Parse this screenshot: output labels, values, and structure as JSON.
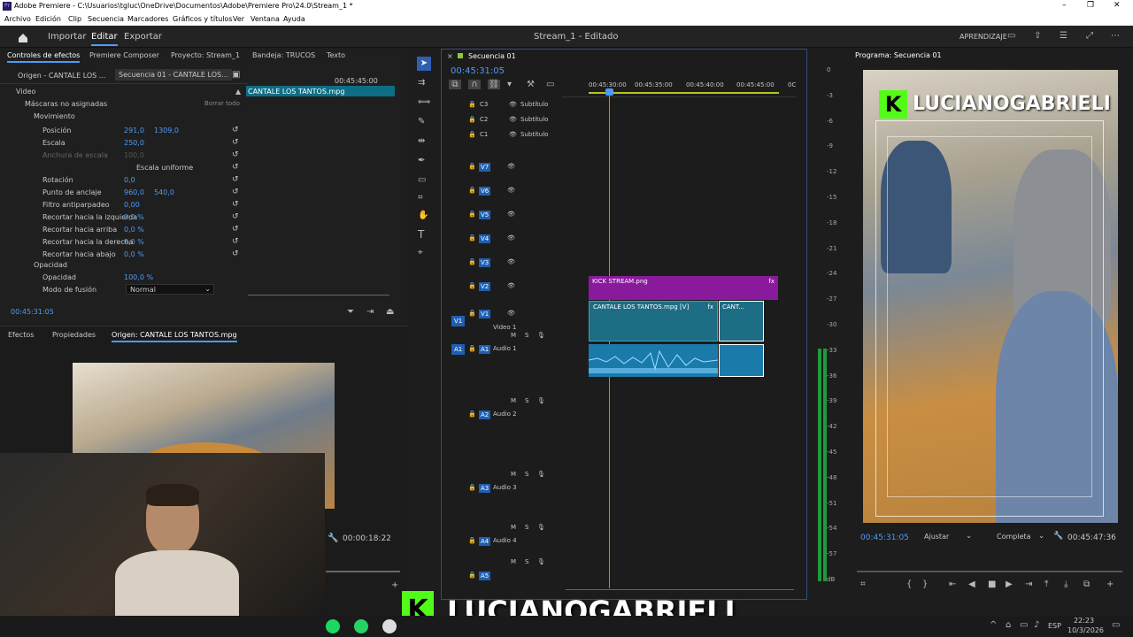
{
  "window": {
    "title": "Adobe Premiere - C:\\Usuarios\\tgluc\\OneDrive\\Documentos\\Adobe\\Premiere Pro\\24.0\\Stream_1 *",
    "controls": [
      "–",
      "❐",
      "✕"
    ]
  },
  "menu": [
    "Archivo",
    "Edición",
    "Clip",
    "Secuencia",
    "Marcadores",
    "Gráficos y títulos",
    "Ver",
    "Ventana",
    "Ayuda"
  ],
  "appbar": {
    "tabs": [
      "Importar",
      "Editar",
      "Exportar"
    ],
    "active": "Editar",
    "center": "Stream_1 - Editado",
    "right": "APRENDIZAJE"
  },
  "panel_tabs": [
    "Controles de efectos",
    "Premiere Composer",
    "Proyecto: Stream_1",
    "Bandeja: TRUCOS",
    "Texto"
  ],
  "effect_controls": {
    "src_tabs": [
      "Origen - CANTALE LOS ...",
      "Secuencia 01 - CANTALE LOS..."
    ],
    "ruler_time": "00:45:45:00",
    "clip_label": "CANTALE LOS TANTOS.mpg",
    "video_label": "Video",
    "masks": "Máscaras no asignadas",
    "reset_all": "Borrar todo",
    "motion": "Movimiento",
    "rows": [
      {
        "name": "Posición",
        "v1": "291,0",
        "v2": "1309,0"
      },
      {
        "name": "Escala",
        "v1": "250,0",
        "v2": ""
      },
      {
        "name": "Anchura de escala",
        "v1": "100,0",
        "v2": ""
      },
      {
        "name": "Escala uniforme",
        "v1": "",
        "v2": ""
      },
      {
        "name": "Rotación",
        "v1": "0,0",
        "v2": ""
      },
      {
        "name": "Punto de anclaje",
        "v1": "960,0",
        "v2": "540,0"
      },
      {
        "name": "Filtro antiparpadeo",
        "v1": "0,00",
        "v2": ""
      },
      {
        "name": "Recortar hacia la izquierda",
        "v1": "0,0 %",
        "v2": ""
      },
      {
        "name": "Recortar hacia arriba",
        "v1": "0,0 %",
        "v2": ""
      },
      {
        "name": "Recortar hacia la derecha",
        "v1": "0,0 %",
        "v2": ""
      },
      {
        "name": "Recortar hacia abajo",
        "v1": "0,0 %",
        "v2": ""
      }
    ],
    "opacity_group": "Opacidad",
    "opacity_name": "Opacidad",
    "opacity_value": "100,0 %",
    "blend_name": "Modo de fusión",
    "blend_value": "Normal",
    "timecode": "00:45:31:05"
  },
  "source_panel": {
    "tabs": [
      "Efectos",
      "Propiedades",
      "Origen: CANTALE LOS TANTOS.mpg"
    ],
    "timecode": "00:00:18:22"
  },
  "timeline": {
    "tab": "Secuencia 01",
    "timecode": "00:45:31:05",
    "ruler": [
      "00:45:30:00",
      "00:45:35:00",
      "00:45:40:00",
      "00:45:45:00",
      "0C"
    ],
    "caption_tracks": [
      {
        "id": "C3",
        "label": "Subtítulo"
      },
      {
        "id": "C2",
        "label": "Subtítulo"
      },
      {
        "id": "C1",
        "label": "Subtítulo"
      }
    ],
    "video_tracks": [
      "V7",
      "V6",
      "V5",
      "V4",
      "V3",
      "V2",
      "V1"
    ],
    "v1_name": "Video 1",
    "v1_src": "V1",
    "audio_tracks": [
      {
        "id": "A1",
        "name": "Audio 1"
      },
      {
        "id": "A2",
        "name": "Audio 2"
      },
      {
        "id": "A3",
        "name": "Audio 3"
      },
      {
        "id": "A4",
        "name": "Audio 4"
      },
      {
        "id": "A5",
        "name": ""
      }
    ],
    "a1_src": "A1",
    "clips": {
      "kick": "KICK STREAM.png",
      "cantale": "CANTALE LOS TANTOS.mpg [V]",
      "cantale_short": "CANT..."
    },
    "meter_labels": [
      "0",
      "-3",
      "-6",
      "-9",
      "-12",
      "-15",
      "-18",
      "-21",
      "-24",
      "-27",
      "-30",
      "-33",
      "-36",
      "-39",
      "-42",
      "-45",
      "-48",
      "-51",
      "-54",
      "-57",
      "dB"
    ]
  },
  "program": {
    "title": "Programa: Secuencia 01",
    "overlay": "LUCIANOGABRIELI",
    "timecode": "00:45:31:05",
    "fit": "Ajustar",
    "quality": "Completa",
    "duration": "00:45:47:36"
  },
  "stream_overlay": {
    "name": "LUCIANOGABRIELI"
  },
  "taskbar": {
    "lang": "ESP",
    "time": "22:23",
    "date": "10/3/2026"
  },
  "colors": {
    "accent": "#4d9bf7",
    "kick_green": "#53fc18",
    "clip_teal": "#1d6d85",
    "clip_purple": "#8a1a9c",
    "audio_clip": "#2a8fbf"
  }
}
